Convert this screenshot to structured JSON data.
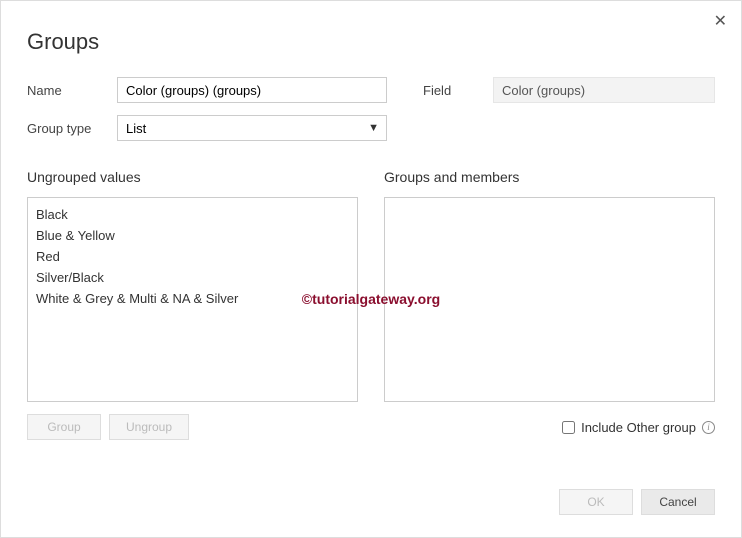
{
  "dialog": {
    "title": "Groups",
    "close_symbol": "✕"
  },
  "form": {
    "name_label": "Name",
    "name_value": "Color (groups) (groups)",
    "field_label": "Field",
    "field_value": "Color (groups)",
    "group_type_label": "Group type",
    "group_type_value": "List"
  },
  "ungrouped": {
    "title": "Ungrouped values",
    "items": [
      "Black",
      "Blue & Yellow",
      "Red",
      "Silver/Black",
      "White & Grey & Multi & NA & Silver"
    ]
  },
  "groups": {
    "title": "Groups and members"
  },
  "buttons": {
    "group": "Group",
    "ungroup": "Ungroup",
    "ok": "OK",
    "cancel": "Cancel"
  },
  "include_other": {
    "label": "Include Other group"
  },
  "watermark": "©tutorialgateway.org"
}
